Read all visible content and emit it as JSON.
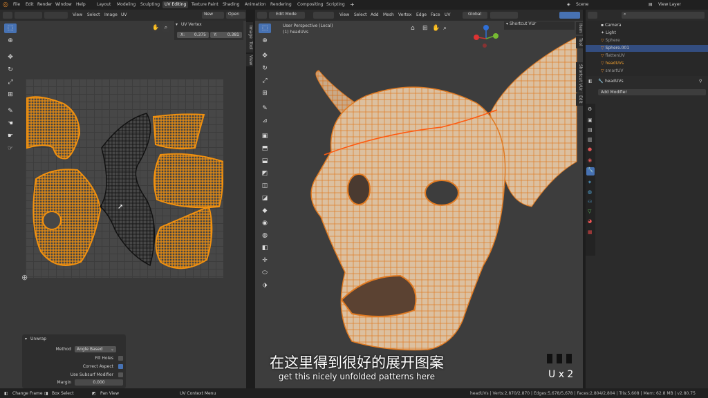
{
  "menus": [
    "File",
    "Edit",
    "Render",
    "Window",
    "Help"
  ],
  "workspaces": [
    "Layout",
    "Modeling",
    "Sculpting",
    "UV Editing",
    "Texture Paint",
    "Shading",
    "Animation",
    "Rendering",
    "Compositing",
    "Scripting"
  ],
  "active_workspace": "UV Editing",
  "scene": {
    "label": "Scene",
    "view_layer": "View Layer"
  },
  "uv_header": {
    "menus": [
      "View",
      "Select",
      "Image",
      "UV"
    ],
    "new_label": "New",
    "open_label": "Open"
  },
  "uv_vertex": {
    "title": "UV Vertex",
    "x_label": "X:",
    "x_value": "0.375",
    "y_label": "Y:",
    "y_value": "0.381"
  },
  "uv_side_tabs": [
    "Image",
    "Tool",
    "View"
  ],
  "unwrap": {
    "title": "Unwrap",
    "method_label": "Method",
    "method_value": "Angle Based",
    "fill_holes": "Fill Holes",
    "correct_aspect": "Correct Aspect",
    "use_subsurf": "Use Subsurf Modifier",
    "margin_label": "Margin",
    "margin_value": "0.000"
  },
  "vp_header": {
    "mode": "Edit Mode",
    "menus": [
      "View",
      "Select",
      "Add",
      "Mesh",
      "Vertex",
      "Edge",
      "Face",
      "UV"
    ],
    "orientation": "Global"
  },
  "viewport": {
    "perspective": "User Perspective (Local)",
    "object": "(1) headUVs",
    "shortcut_panel": "Shortcut VUr"
  },
  "vp_side_tabs": [
    "Shortcut VUr",
    "Edit",
    "Tool",
    "Item"
  ],
  "outliner": [
    {
      "name": "Camera",
      "type": "camera"
    },
    {
      "name": "Light",
      "type": "light"
    },
    {
      "name": "Sphere",
      "type": "mesh"
    },
    {
      "name": "Sphere.001",
      "type": "mesh",
      "selected": true
    },
    {
      "name": "flattenUV",
      "type": "mesh"
    },
    {
      "name": "headUVs",
      "type": "mesh",
      "active": true
    },
    {
      "name": "smartUV",
      "type": "mesh"
    }
  ],
  "properties": {
    "object_name": "headUVs",
    "add_modifier": "Add Modifier"
  },
  "subtitle": {
    "chinese": "在这里得到很好的展开图案",
    "english": "get this nicely unfolded patterns here"
  },
  "key_overlay": "U x 2",
  "status": {
    "left": [
      "Change Frame",
      "Box Select",
      "Pan View",
      "UV Context Menu"
    ],
    "stats": "headUVs | Verts:2,870/2,870 | Edges:5,678/5,678 | Faces:2,804/2,804 | Tris:5,608 | Mem: 62.8 MB | v2.80.75"
  },
  "colors": {
    "accent": "#4772b3",
    "orange": "#f0900f",
    "selected_row": "#334d80"
  }
}
